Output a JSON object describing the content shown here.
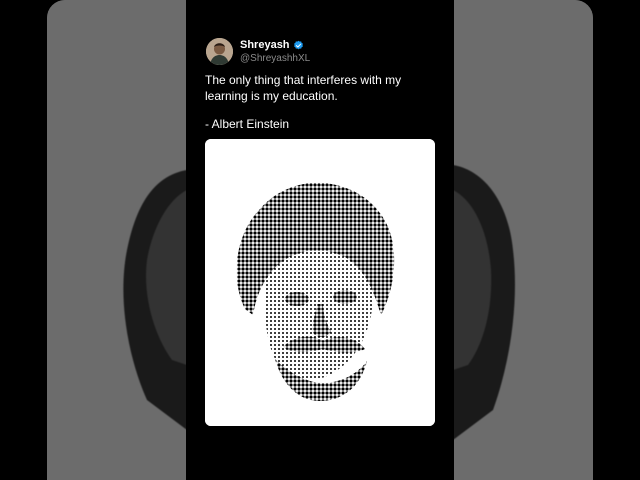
{
  "tweet": {
    "display_name": "Shreyash",
    "handle": "@ShreyashhXL",
    "text_line1": "The only thing that interferes with my",
    "text_line2": "learning is my education.",
    "attribution": "- Albert Einstein",
    "verified": true
  },
  "icons": {
    "verified": "verified-badge-icon",
    "avatar": "avatar"
  },
  "colors": {
    "background": "#000000",
    "text": "#ffffff",
    "handle": "#8b8b8b",
    "verified_badge": "#1d9bf0",
    "media_background": "#ffffff",
    "halftone_dots": "#000000"
  }
}
